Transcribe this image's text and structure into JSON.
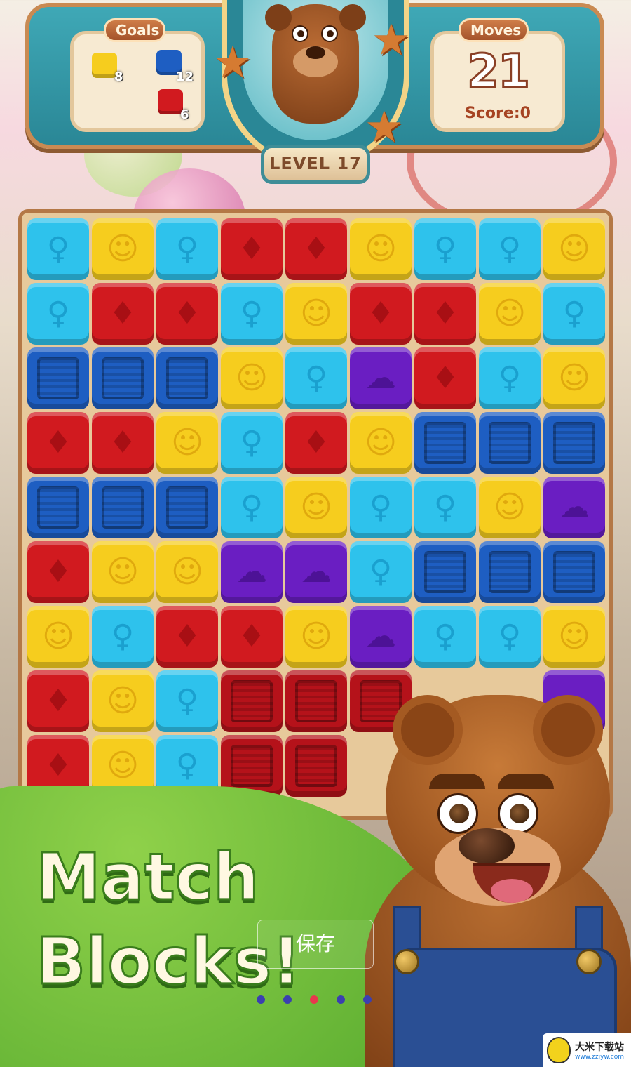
{
  "hud": {
    "goals_label": "Goals",
    "moves_label": "Moves",
    "moves_value": "21",
    "score_text": "Score:0",
    "level_text": "LEVEL 17",
    "goals": [
      {
        "color": "#f6cd1e",
        "count": "8"
      },
      {
        "color": "#1e5ec2",
        "count": "12"
      },
      {
        "color": "#d11a1f",
        "count": "6"
      }
    ]
  },
  "board": {
    "rows": [
      [
        "cyan",
        "yellow",
        "cyan",
        "red",
        "red",
        "yellow",
        "cyan",
        "cyan",
        "yellow"
      ],
      [
        "cyan",
        "red",
        "red",
        "cyan",
        "yellow",
        "red",
        "red",
        "yellow",
        "cyan"
      ],
      [
        "crate-blue",
        "crate-blue",
        "crate-blue",
        "yellow",
        "cyan",
        "purple",
        "red",
        "cyan",
        "yellow"
      ],
      [
        "red",
        "red",
        "yellow",
        "cyan",
        "red",
        "yellow",
        "crate-blue",
        "crate-blue",
        "crate-blue"
      ],
      [
        "crate-blue",
        "crate-blue",
        "crate-blue",
        "cyan",
        "yellow",
        "cyan",
        "cyan",
        "yellow",
        "purple"
      ],
      [
        "red",
        "yellow",
        "yellow",
        "purple",
        "purple",
        "cyan",
        "crate-blue",
        "crate-blue",
        "crate-blue"
      ],
      [
        "yellow",
        "cyan",
        "red",
        "red",
        "yellow",
        "purple",
        "cyan",
        "cyan",
        "yellow"
      ],
      [
        "red",
        "yellow",
        "cyan",
        "crate-red",
        "crate-red",
        "crate-red",
        "",
        "",
        "purple"
      ],
      [
        "red",
        "yellow",
        "cyan",
        "crate-red",
        "crate-red",
        "",
        "",
        "",
        ""
      ]
    ],
    "symbols": {
      "yellow": "☺",
      "cyan": "♀",
      "red": "♦",
      "purple": "☁",
      "blue": "",
      "crate-blue": "",
      "crate-red": ""
    }
  },
  "banner": {
    "line1": "Match",
    "line2": "Blocks!"
  },
  "overlay": {
    "save_label": "保存",
    "dots": [
      false,
      false,
      true,
      false,
      false
    ],
    "dot_color": "#3b3fb0",
    "active_dot_color": "#e8384d"
  },
  "watermark": {
    "name": "大米下载站",
    "url": "www.zziyw.com"
  }
}
